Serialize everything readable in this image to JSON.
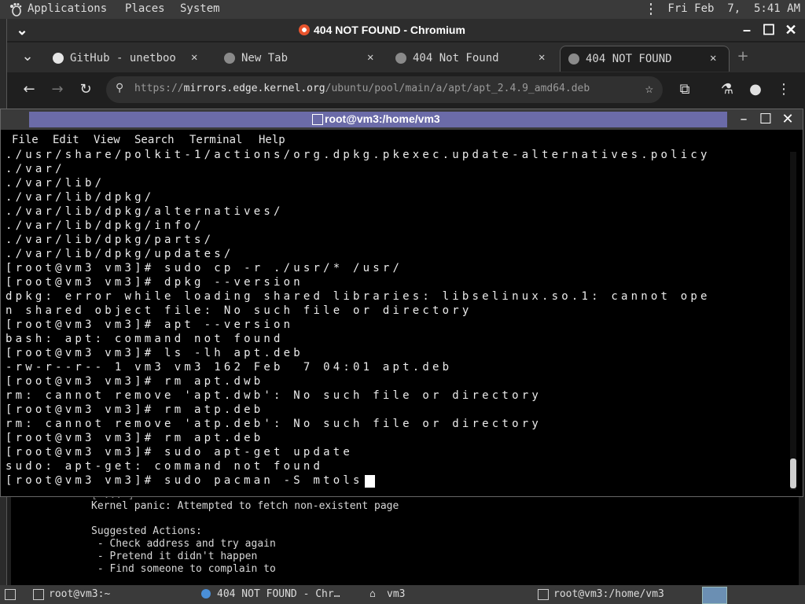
{
  "panel": {
    "menus": [
      "Applications",
      "Places",
      "System"
    ],
    "clock": "Fri Feb  7,  5:41 AM"
  },
  "chromium": {
    "window_title": "404 NOT FOUND - Chromium",
    "tabs": [
      {
        "label": "GitHub - unetboo",
        "icon": "github-icon"
      },
      {
        "label": "New Tab",
        "icon": "globe-icon"
      },
      {
        "label": "404 Not Found",
        "icon": "globe-icon"
      },
      {
        "label": "404 NOT FOUND",
        "icon": "globe-icon",
        "active": true
      }
    ],
    "url_prefix": "https://",
    "url_host": "mirrors.edge.kernel.org",
    "url_path": "/ubuntu/pool/main/a/apt/apt_2.4.9_amd64.deb"
  },
  "webpage": {
    "lines": [
      "[ ... ]",
      "Kernel panic: Attempted to fetch non-existent page",
      "",
      "Suggested Actions:",
      " - Check address and try again",
      " - Pretend it didn't happen",
      " - Find someone to complain to"
    ]
  },
  "terminal": {
    "window_title": "root@vm3:/home/vm3",
    "menu": [
      "File",
      "Edit",
      "View",
      "Search",
      "Terminal",
      "Help"
    ],
    "lines": [
      "./usr/share/polkit-1/actions/org.dpkg.pkexec.update-alternatives.policy",
      "./var/",
      "./var/lib/",
      "./var/lib/dpkg/",
      "./var/lib/dpkg/alternatives/",
      "./var/lib/dpkg/info/",
      "./var/lib/dpkg/parts/",
      "./var/lib/dpkg/updates/",
      "[root@vm3 vm3]# sudo cp -r ./usr/* /usr/",
      "[root@vm3 vm3]# dpkg --version",
      "dpkg: error while loading shared libraries: libselinux.so.1: cannot ope",
      "n shared object file: No such file or directory",
      "[root@vm3 vm3]# apt --version",
      "bash: apt: command not found",
      "[root@vm3 vm3]# ls -lh apt.deb",
      "-rw-r--r-- 1 vm3 vm3 162 Feb  7 04:01 apt.deb",
      "[root@vm3 vm3]# rm apt.dwb",
      "rm: cannot remove 'apt.dwb': No such file or directory",
      "[root@vm3 vm3]# rm atp.deb",
      "rm: cannot remove 'atp.deb': No such file or directory",
      "[root@vm3 vm3]# rm apt.deb",
      "[root@vm3 vm3]# sudo apt-get update",
      "sudo: apt-get: command not found",
      "[root@vm3 vm3]# sudo pacman -S mtols"
    ]
  },
  "taskbar": {
    "items": [
      "root@vm3:~",
      "404 NOT FOUND - Chr…",
      "vm3",
      "root@vm3:/home/vm3"
    ]
  },
  "colors": {
    "panel": "#3a3a3a",
    "terminal_title_bar": "#6b6ba8",
    "terminal_bg": "#000000",
    "terminal_fg": "#ececec"
  }
}
